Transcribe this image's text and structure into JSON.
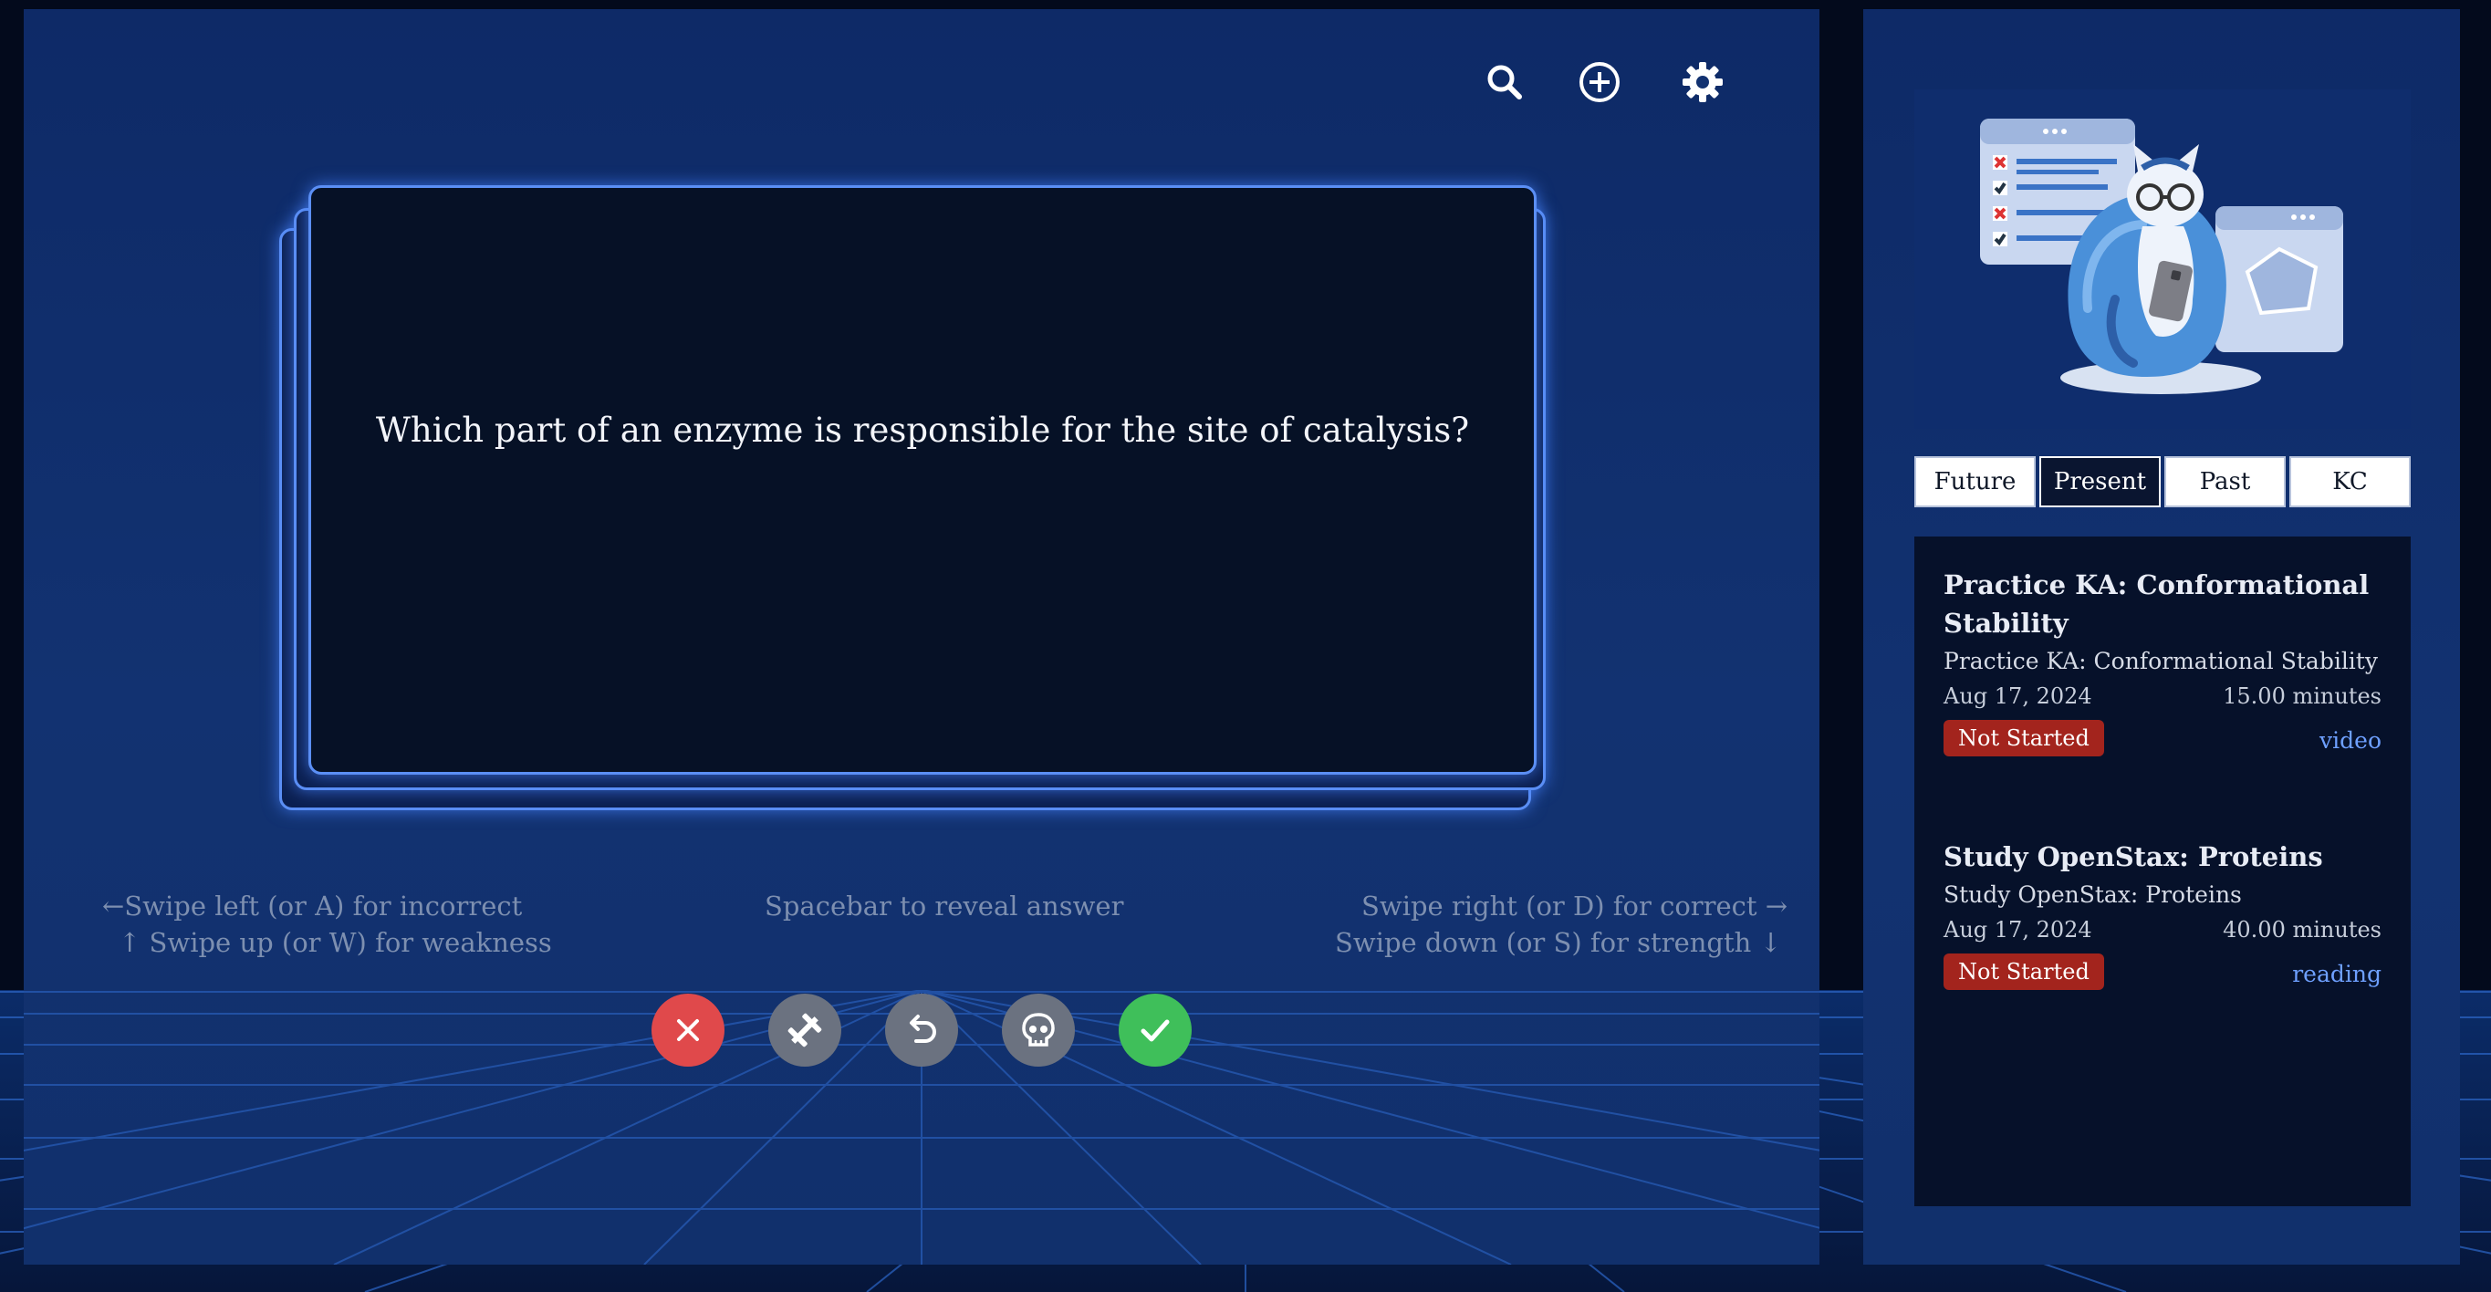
{
  "card": {
    "question": "Which part of an enzyme is responsible for the site of catalysis?"
  },
  "toolbar": {
    "icons": [
      "search-icon",
      "add-circle-icon",
      "gear-icon"
    ]
  },
  "hints": {
    "left_1": "←Swipe left (or A) for incorrect",
    "left_2": "↑ Swipe up (or W) for weakness",
    "center": "Spacebar to reveal answer",
    "right_1": "Swipe right (or D) for correct →",
    "right_2": "Swipe down (or S) for strength ↓"
  },
  "actions": [
    {
      "icon": "close-icon",
      "color": "#e0494b"
    },
    {
      "icon": "dumbbell-icon",
      "color": "#6b7280"
    },
    {
      "icon": "undo-icon",
      "color": "#6b7280"
    },
    {
      "icon": "skull-icon",
      "color": "#6b7280"
    },
    {
      "icon": "check-icon",
      "color": "#3fbf5a"
    }
  ],
  "tabs": [
    "Future",
    "Present",
    "Past",
    "KC"
  ],
  "active_tab": "Present",
  "items": [
    {
      "title": "Practice KA: Conformational Stability",
      "subtitle": "Practice KA: Conformational Stability",
      "date": "Aug 17, 2024",
      "duration": "15.00 minutes",
      "status": "Not Started",
      "type": "video"
    },
    {
      "title": "Study OpenStax: Proteins",
      "subtitle": "Study OpenStax: Proteins",
      "date": "Aug 17, 2024",
      "duration": "40.00 minutes",
      "status": "Not Started",
      "type": "reading"
    }
  ],
  "colors": {
    "accent": "#5b8ff5",
    "incorrect": "#e0494b",
    "correct": "#3fbf5a",
    "badge": "#a3241d"
  }
}
